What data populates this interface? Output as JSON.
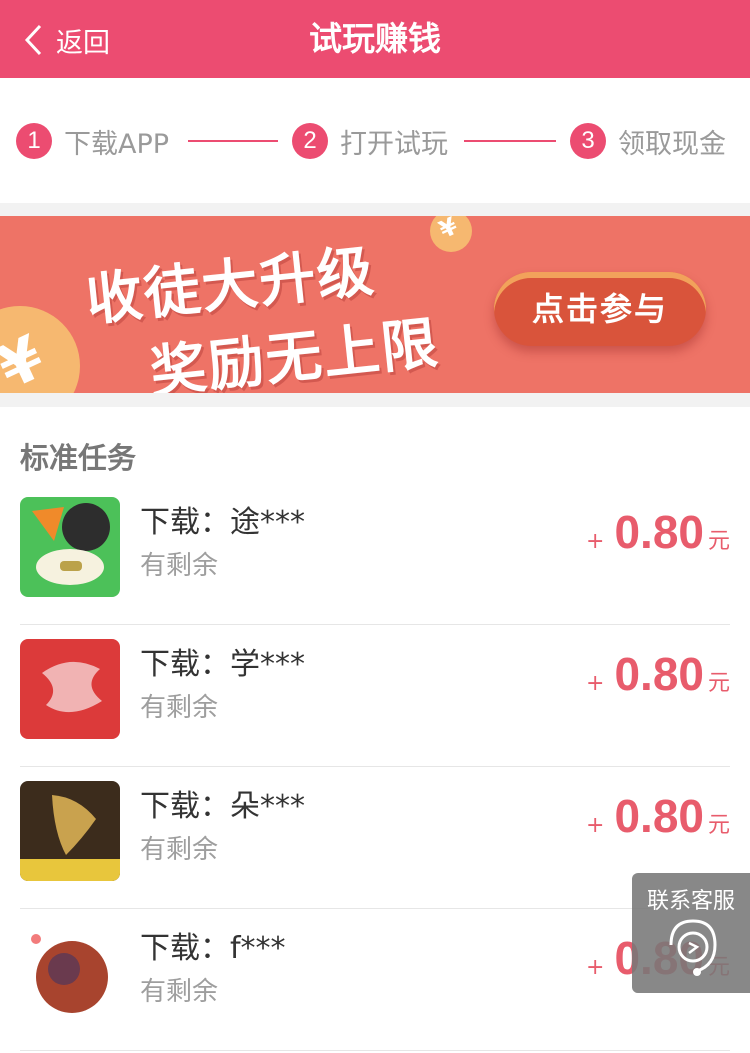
{
  "header": {
    "back_label": "返回",
    "title": "试玩赚钱"
  },
  "steps": [
    {
      "num": "1",
      "label": "下载APP"
    },
    {
      "num": "2",
      "label": "打开试玩"
    },
    {
      "num": "3",
      "label": "领取现金"
    }
  ],
  "banner": {
    "line1": "收徒大升级",
    "line2": "奖励无上限",
    "button_label": "点击参与",
    "coin_symbol": "¥"
  },
  "section_title": "标准任务",
  "tasks": [
    {
      "name": "下载：途***",
      "status": "有剩余",
      "plus": "+",
      "amount": "0.80",
      "unit": "元"
    },
    {
      "name": "下载：学***",
      "status": "有剩余",
      "plus": "+",
      "amount": "0.80",
      "unit": "元"
    },
    {
      "name": "下载：朵***",
      "status": "有剩余",
      "plus": "+",
      "amount": "0.80",
      "unit": "元"
    },
    {
      "name": "下载：f***",
      "status": "有剩余",
      "plus": "+",
      "amount": "0.80",
      "unit": "元"
    }
  ],
  "service_button": {
    "label": "联系客服"
  },
  "colors": {
    "brand": "#ec4c71",
    "banner": "#ee7366",
    "price": "#e85c6c"
  }
}
